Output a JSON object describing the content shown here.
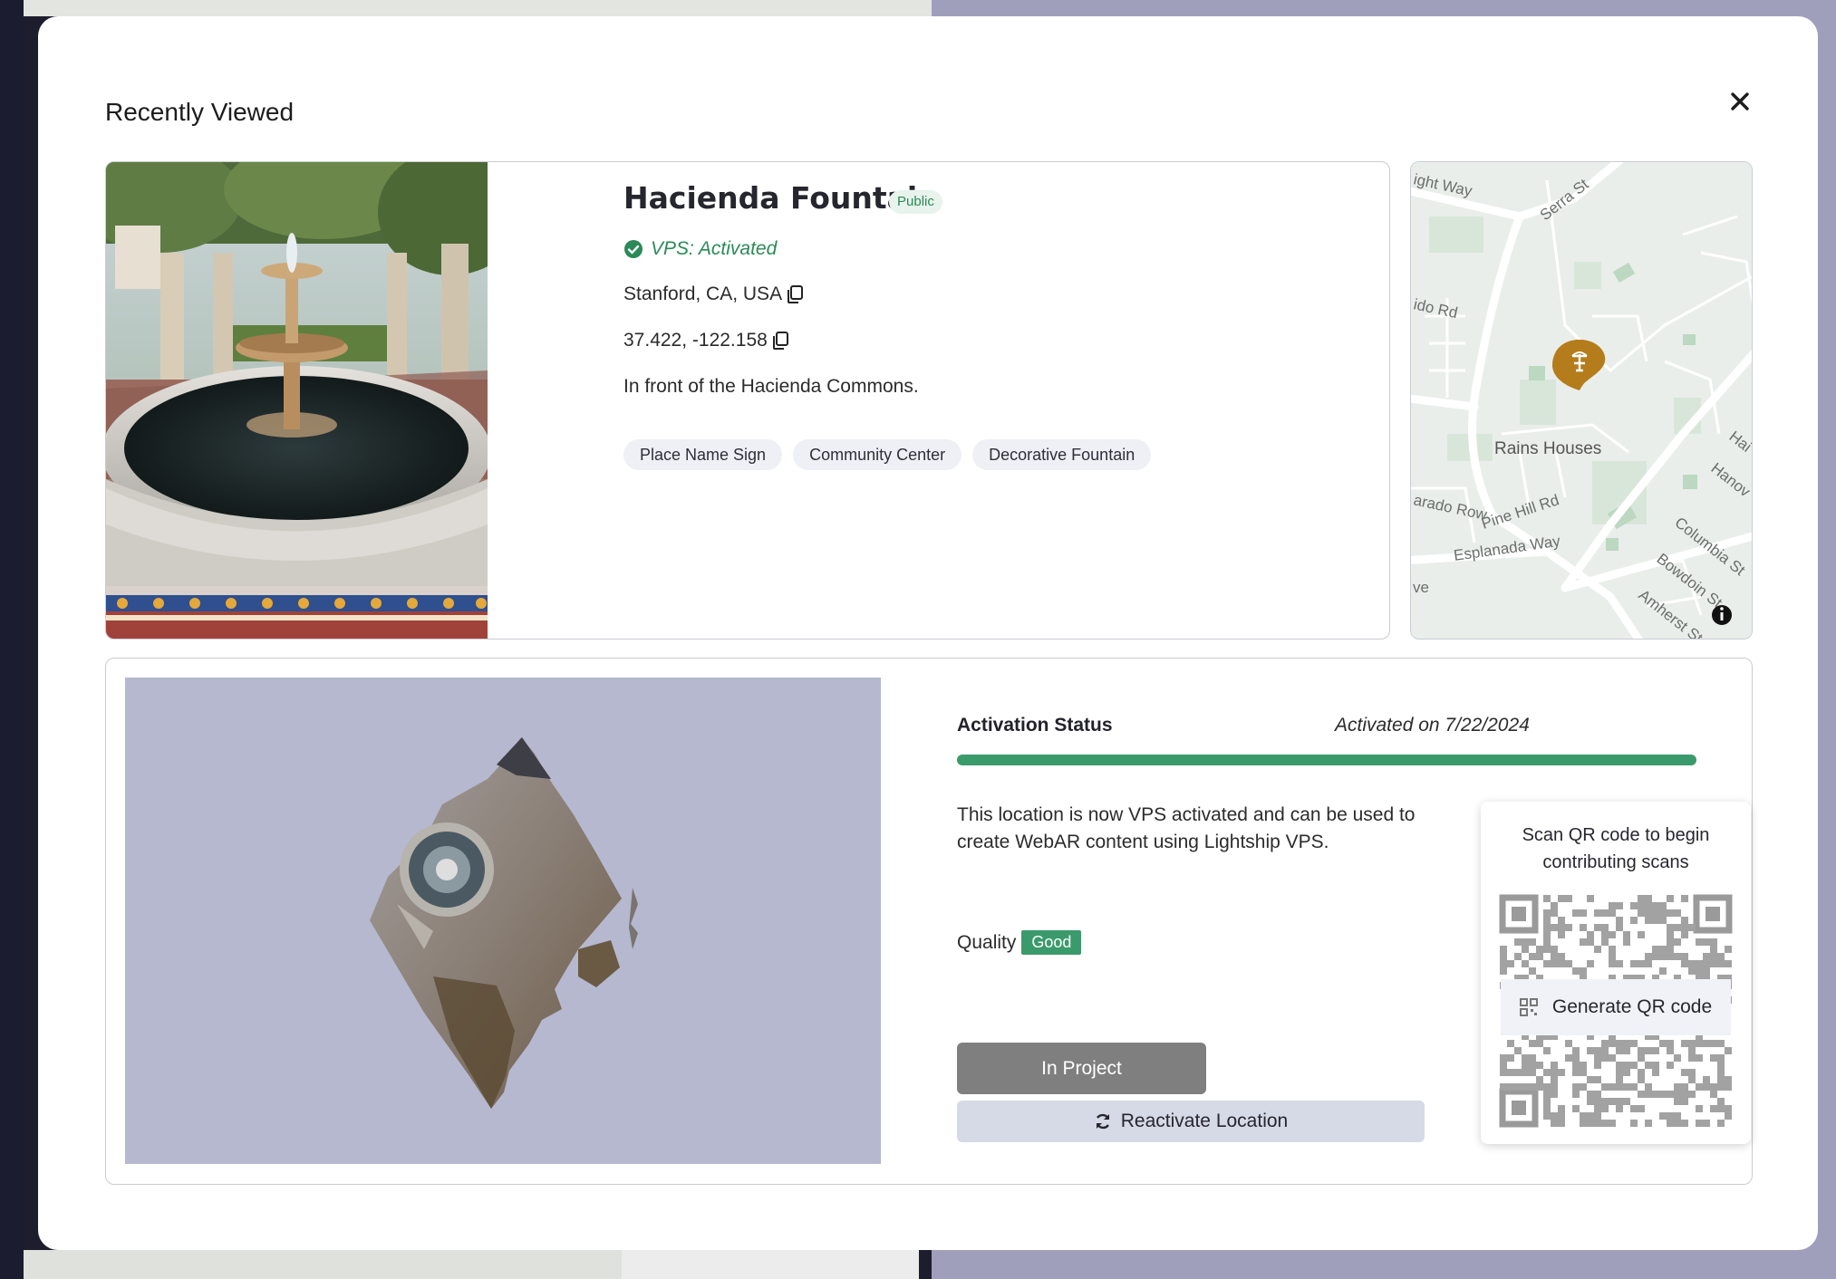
{
  "modal": {
    "title": "Recently Viewed",
    "close_icon": "close-icon"
  },
  "location": {
    "name": "Hacienda Fountain",
    "visibility_badge": "Public",
    "vps_status": "VPS: Activated",
    "address": "Stanford, CA, USA",
    "coordinates": "37.422, -122.158",
    "description": "In front of the Hacienda Commons.",
    "tags": [
      "Place Name Sign",
      "Community Center",
      "Decorative Fountain"
    ]
  },
  "map": {
    "labels": [
      "Serra St",
      "ight Way",
      "Rains Houses",
      "Pine Hill Rd",
      "Esplanada Way",
      "Columbia St",
      "Bowdoin St",
      "Amherst St",
      "Hanov",
      "Hai",
      "ido Rd",
      "arado Row",
      "ve"
    ],
    "pin_icon": "fountain-pin-icon",
    "info_icon": "info-icon"
  },
  "activation": {
    "title": "Activation Status",
    "date": "Activated on 7/22/2024",
    "progress": 1.0,
    "description": "This location is now VPS activated and can be used to create WebAR content using Lightship VPS.",
    "quality_label": "Quality",
    "quality_value": "Good",
    "in_project_label": "In Project",
    "reactivate_label": "Reactivate Location",
    "qr_title": "Scan QR code to begin contributing scans",
    "qr_button_label": "Generate QR code"
  },
  "colors": {
    "accent_green": "#3b9a6b",
    "public_badge_text": "#2b8a57",
    "scan_background": "#b5b8cf",
    "map_pin": "#b57c1b"
  }
}
